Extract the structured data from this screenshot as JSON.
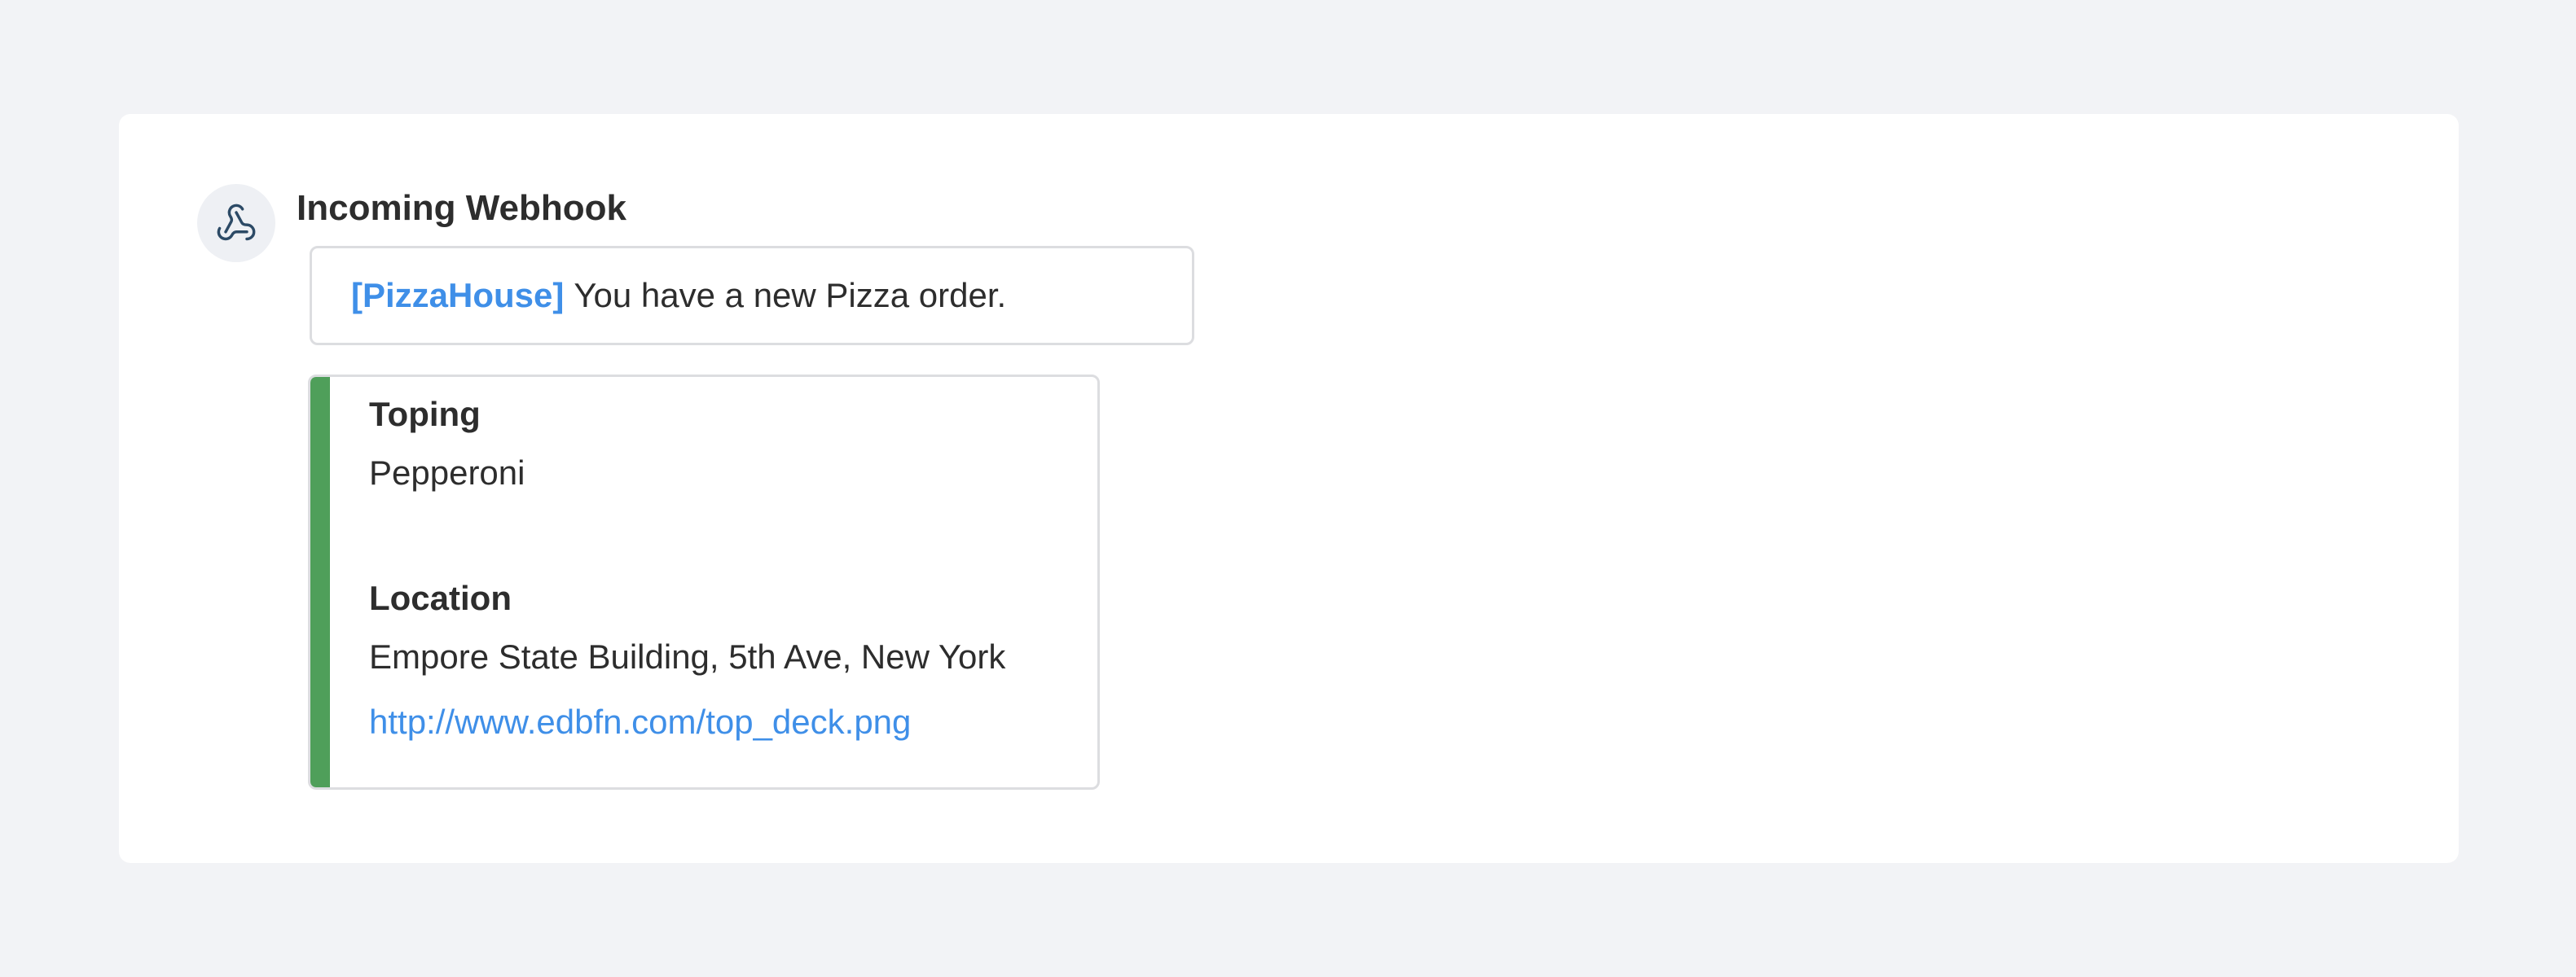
{
  "message": {
    "sender": "Incoming Webhook",
    "avatar_icon": "webhook-icon",
    "tag": "[PizzaHouse]",
    "text": "You have a new Pizza order."
  },
  "attachment": {
    "accent_color": "#4f9f5a",
    "fields": [
      {
        "title": "Toping",
        "value": "Pepperoni"
      },
      {
        "title": "Location",
        "value": "Empore State Building, 5th Ave, New York"
      }
    ],
    "link": "http://www.edbfn.com/top_deck.png"
  },
  "colors": {
    "background": "#f2f3f6",
    "card": "#ffffff",
    "link": "#3f8fe8",
    "border": "#dcdde0"
  }
}
